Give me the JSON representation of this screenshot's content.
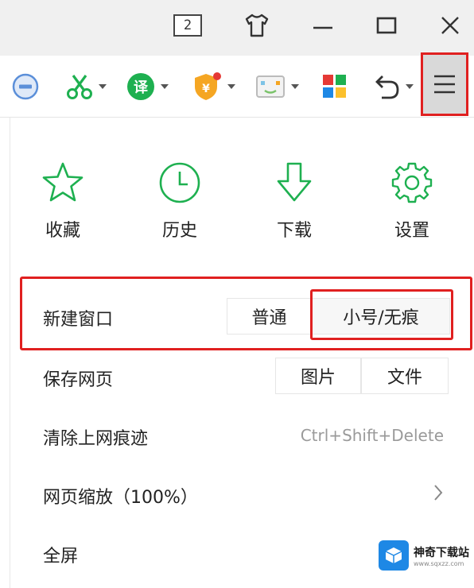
{
  "titlebar": {
    "tab_count": "2",
    "icons": [
      "skin-icon",
      "minimize-icon",
      "maximize-icon",
      "close-icon"
    ]
  },
  "toolbar": {
    "icons": [
      "adblock-icon",
      "screenshot-icon",
      "translate-icon",
      "shield-icon",
      "game-icon",
      "apps-icon",
      "undo-icon",
      "menu-icon"
    ],
    "accent": "#1eb050"
  },
  "quick_actions": [
    {
      "label": "收藏",
      "icon": "star-icon"
    },
    {
      "label": "历史",
      "icon": "clock-icon"
    },
    {
      "label": "下载",
      "icon": "download-icon"
    },
    {
      "label": "设置",
      "icon": "gear-icon"
    }
  ],
  "menu": {
    "new_window": {
      "label": "新建窗口",
      "normal": "普通",
      "incognito": "小号/无痕"
    },
    "save_page": {
      "label": "保存网页",
      "image": "图片",
      "file": "文件"
    },
    "clear_traces": {
      "label": "清除上网痕迹",
      "shortcut": "Ctrl+Shift+Delete"
    },
    "zoom": {
      "label": "网页缩放（100%）"
    },
    "fullscreen": {
      "label": "全屏"
    }
  },
  "watermark": {
    "title": "神奇下载站",
    "url": "www.sqxzz.com"
  },
  "colors": {
    "highlight": "#e02020",
    "icon_green": "#1eb050"
  }
}
